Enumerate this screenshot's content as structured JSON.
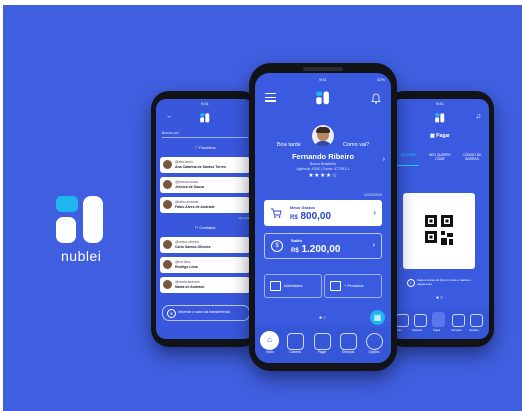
{
  "brand": {
    "name": "nublei"
  },
  "left_phone": {
    "search_placeholder": "Buscar por",
    "favorites_label": "Favoritos",
    "contacts_label": "Contatos",
    "see_more": "Ver mais",
    "favorites": [
      {
        "handle": "@ana.bento",
        "name": "Ana Catarina de Santos Torres"
      },
      {
        "handle": "@jessica.sousa",
        "name": "Jéssica de Souza"
      },
      {
        "handle": "@fabio.andrade",
        "name": "Fábio Alves de Andrade"
      }
    ],
    "contacts": [
      {
        "handle": "@carlos.oliveira",
        "name": "Carlo Santos Oliveira"
      },
      {
        "handle": "@rod.lima",
        "name": "Rodrigo Lima"
      },
      {
        "handle": "@marta.andrade",
        "name": "Marta de Andrade"
      }
    ],
    "transfer_input": "Informar o valor da transferência"
  },
  "center_phone": {
    "status_time": "9:41",
    "status_battery": "42%",
    "greeting_left": "Boa tarde",
    "greeting_right": "Como vai?",
    "user_name": "Fernando Ribeiro",
    "bank_name": "Banco Brasileiro",
    "account_info": "Agência: 4345 | Conta: 477391-1",
    "stars": "★★★★☆",
    "date": "12/03/2019",
    "expenses": {
      "label": "Meus Gastos",
      "currency": "R$",
      "value": "800,00"
    },
    "balance": {
      "label": "Saldo",
      "currency": "R$",
      "value": "1.200,00"
    },
    "activities_label": "Atividades",
    "products_label": "+ Produtos",
    "nav": [
      "Início",
      "Carteira",
      "Pagar",
      "Serviços",
      "Opções"
    ]
  },
  "right_phone": {
    "title": "Pagar",
    "tabs": [
      "QR CODE",
      "NEO QUERRY CODE",
      "CÓDIGO DE BARRAS"
    ],
    "hint": "Faça a leitura do Quero Code e realize o pagamento",
    "nav": [
      "Início",
      "Carteira",
      "Pagar",
      "Serviços",
      "Opções"
    ]
  },
  "colors": {
    "background": "#3f5fe0",
    "screen": "#3a5be0",
    "accent": "#1fb6f0"
  }
}
